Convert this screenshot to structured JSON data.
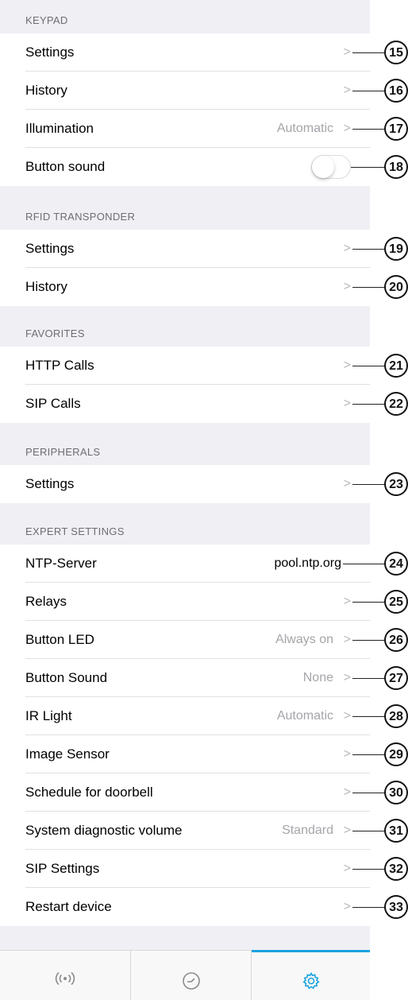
{
  "sections": [
    {
      "header": "KEYPAD",
      "rows": [
        {
          "label": "Settings",
          "value": "",
          "callout": "15"
        },
        {
          "label": "History",
          "value": "",
          "callout": "16"
        },
        {
          "label": "Illumination",
          "value": "Automatic",
          "callout": "17"
        },
        {
          "label": "Button sound",
          "value": "",
          "toggle": "off",
          "callout": "18"
        }
      ]
    },
    {
      "header": "RFID TRANSPONDER",
      "rows": [
        {
          "label": "Settings",
          "value": "",
          "callout": "19"
        },
        {
          "label": "History",
          "value": "",
          "callout": "20"
        }
      ]
    },
    {
      "header": "FAVORITES",
      "rows": [
        {
          "label": "HTTP Calls",
          "value": "",
          "callout": "21"
        },
        {
          "label": "SIP Calls",
          "value": "",
          "callout": "22"
        }
      ]
    },
    {
      "header": "PERIPHERALS",
      "rows": [
        {
          "label": "Settings",
          "value": "",
          "callout": "23"
        }
      ]
    },
    {
      "header": "EXPERT SETTINGS",
      "rows": [
        {
          "label": "NTP-Server",
          "value": "pool.ntp.org",
          "callout": "24"
        },
        {
          "label": "Relays",
          "value": "",
          "callout": "25"
        },
        {
          "label": "Button LED",
          "value": "Always on",
          "callout": "26"
        },
        {
          "label": "Button Sound",
          "value": "None",
          "callout": "27"
        },
        {
          "label": "IR Light",
          "value": "Automatic",
          "callout": "28"
        },
        {
          "label": "Image Sensor",
          "value": "",
          "callout": "29"
        },
        {
          "label": "Schedule for doorbell",
          "value": "",
          "callout": "30"
        },
        {
          "label": "System diagnostic volume",
          "value": "Standard",
          "callout": "31"
        },
        {
          "label": "SIP Settings",
          "value": "",
          "callout": "32"
        },
        {
          "label": "Restart device",
          "value": "",
          "callout": "33"
        }
      ]
    }
  ],
  "tabbar": {
    "tabs": [
      {
        "icon": "broadcast-icon",
        "active": false
      },
      {
        "icon": "history-clock-icon",
        "active": false
      },
      {
        "icon": "settings-gear-icon",
        "active": true
      }
    ],
    "active_color": "#1aa3e0"
  },
  "colors": {
    "section_bg": "#efeff4",
    "callout": "#111111"
  }
}
